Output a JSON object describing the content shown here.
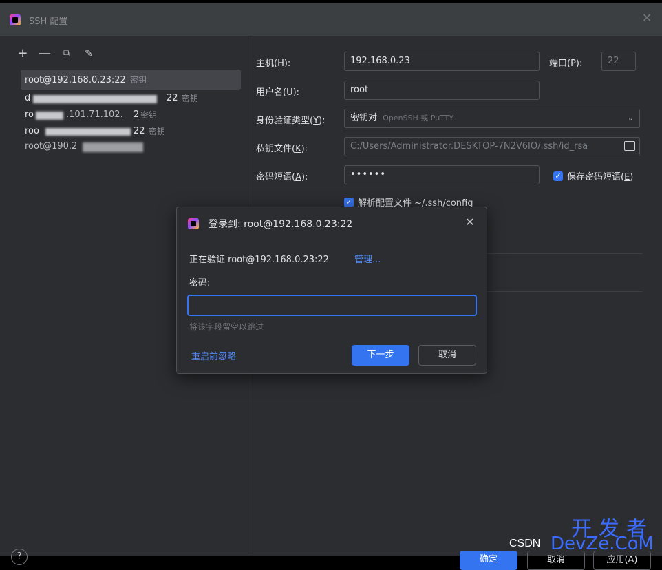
{
  "window": {
    "title": "SSH 配置"
  },
  "toolbar": {
    "add": "+",
    "remove": "—",
    "copy": "⧉",
    "edit": "✎"
  },
  "hosts": [
    {
      "label": "root@192.168.0.23:22",
      "tag": "密钥",
      "selected": true
    },
    {
      "label": "d",
      "tail": "22",
      "tag": "密钥"
    },
    {
      "label": "ro",
      "mid": ".101.71.102.",
      "tail": "2",
      "tag": "密钥"
    },
    {
      "label": "roo",
      "tail": "22",
      "tag": "密钥"
    },
    {
      "label": "root@190.2",
      "tail": ""
    }
  ],
  "form": {
    "host_label_pre": "主机(",
    "host_label_key": "H",
    "host_label_post": "):",
    "host_value": "192.168.0.23",
    "port_label_pre": "端口(",
    "port_label_key": "P",
    "port_label_post": "):",
    "port_value": "22",
    "user_label_pre": "用户名(",
    "user_label_key": "U",
    "user_label_post": "):",
    "user_value": "root",
    "auth_label_pre": "身份验证类型(",
    "auth_label_key": "Y",
    "auth_label_post": "):",
    "auth_value": "密钥对",
    "auth_hint": "OpenSSH 或 PuTTY",
    "key_label_pre": "私钥文件(",
    "key_label_key": "K",
    "key_label_post": "):",
    "key_value": "C:/Users/Administrator.DESKTOP-7N2V6IO/.ssh/id_rsa",
    "pass_label_pre": "密码短语(",
    "pass_label_key": "A",
    "pass_label_post": "):",
    "pass_value": "••••••",
    "save_pass_pre": "保存密码短语(",
    "save_pass_key": "E",
    "save_pass_post": ")",
    "parse_config": "解析配置文件 ~/.ssh/config",
    "check_mark": "✓"
  },
  "dialog": {
    "title": "登录到: root@192.168.0.23:22",
    "verifying": "正在验证 root@192.168.0.23:22",
    "manage": "管理...",
    "password_label": "密码:",
    "password_value": "",
    "hint": "将该字段留空以跳过",
    "ignore_until_restart": "重启前忽略",
    "next": "下一步",
    "cancel": "取消",
    "close": "✕"
  },
  "bottom": {
    "help": "?",
    "ok": "确定",
    "cancel": "取消",
    "apply": "应用(A)"
  },
  "watermark": {
    "big": "开发者",
    "csdn": "CSDN",
    "devze": "DevZe.CoM"
  },
  "colors": {
    "accent": "#3574f0",
    "background": "#2b2d30",
    "titlebar": "#3c3f41"
  }
}
